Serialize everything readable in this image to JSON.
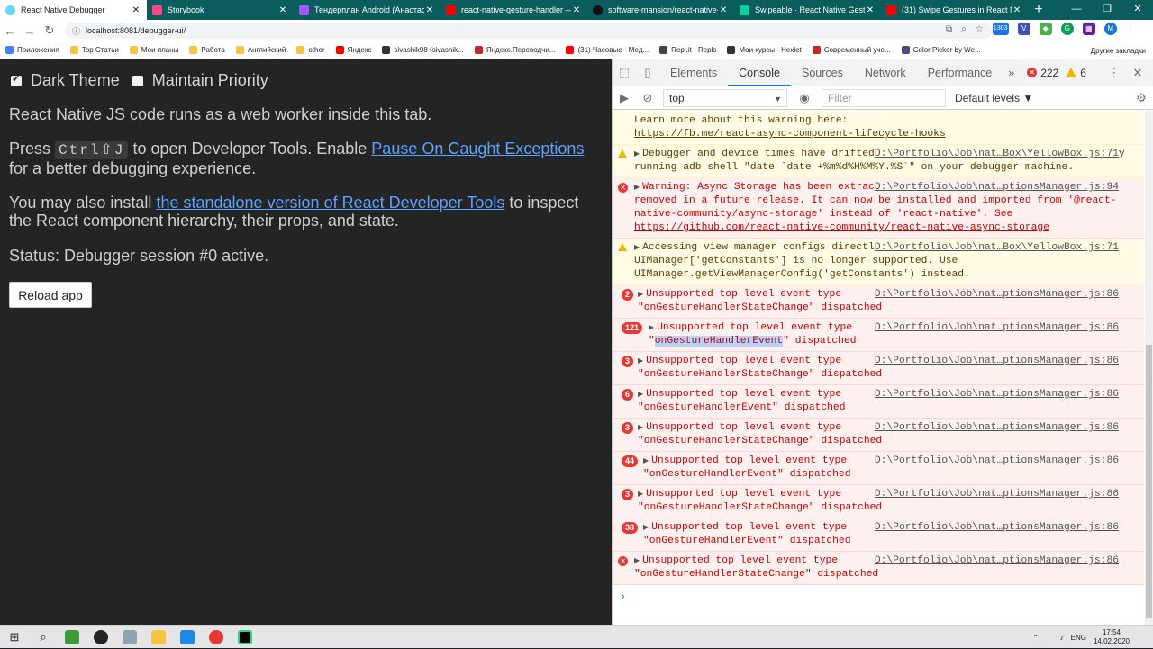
{
  "browser": {
    "tabs": [
      {
        "title": "React Native Debugger",
        "icon": "react-icon",
        "color": "#61dafb"
      },
      {
        "title": "Storybook",
        "icon": "storybook-icon",
        "color": "#ff4785"
      },
      {
        "title": "Тендерплан Android (Анастаси",
        "icon": "figma-icon",
        "color": "#a259ff"
      },
      {
        "title": "react-native-gesture-handler — ",
        "icon": "yandex-icon",
        "color": "#ff0000"
      },
      {
        "title": "software-mansion/react-native-",
        "icon": "github-icon",
        "color": "#000000"
      },
      {
        "title": "Swipeable · React Native Gesture",
        "icon": "swipe-icon",
        "color": "#0bcfa0"
      },
      {
        "title": "(31) Swipe Gestures in React Nati",
        "icon": "youtube-icon",
        "color": "#ff0000"
      }
    ],
    "new_tab": "+",
    "url": "localhost:8081/debugger-ui/",
    "bookmarks": [
      {
        "label": "Приложения",
        "color": "#4285f4"
      },
      {
        "label": "Top Статьи",
        "color": "#f6c343"
      },
      {
        "label": "Мои планы",
        "color": "#f6c343"
      },
      {
        "label": "Работа",
        "color": "#f6c343"
      },
      {
        "label": "Английский",
        "color": "#f6c343"
      },
      {
        "label": "other",
        "color": "#f6c343"
      },
      {
        "label": "Яндекс",
        "color": "#ff0000"
      },
      {
        "label": "sivashik98 (sivashik...",
        "color": "#333333"
      },
      {
        "label": "Яндекс.Переводчи...",
        "color": "#c62828"
      },
      {
        "label": "(31) Часовые - Мед...",
        "color": "#ff0000"
      },
      {
        "label": "Repl.it - Repls",
        "color": "#444444"
      },
      {
        "label": "Мои курсы - Hexlet",
        "color": "#333333"
      },
      {
        "label": "Современный уче...",
        "color": "#c62828"
      },
      {
        "label": "Color Picker by We...",
        "color": "#4a4a8a"
      }
    ],
    "other_bookmarks": "Другие закладки",
    "ext_badge": "1303"
  },
  "page": {
    "dark_theme_label": "Dark Theme",
    "maintain_priority_label": "Maintain Priority",
    "p1": "React Native JS code runs as a web worker inside this tab.",
    "p2_before": "Press ",
    "p2_kbd": "Ctrl⇧J",
    "p2_mid": " to open Developer Tools. Enable ",
    "p2_link": "Pause On Caught Exceptions",
    "p2_after": " for a better debugging experience.",
    "p3_before": "You may also install ",
    "p3_link": "the standalone version of React Developer Tools",
    "p3_after": " to inspect the React component hierarchy, their props, and state.",
    "status": "Status: Debugger session #0 active.",
    "reload_label": "Reload app"
  },
  "devtools": {
    "tabs": [
      "Elements",
      "Console",
      "Sources",
      "Network",
      "Performance"
    ],
    "active_tab": "Console",
    "more": "»",
    "error_count": "222",
    "warning_count": "6",
    "context": "top",
    "filter_placeholder": "Filter",
    "levels": "Default levels ▼",
    "messages": {
      "m0_text": "Learn more about this warning here:",
      "m0_link": "https://fb.me/react-async-component-lifecycle-hooks",
      "m1_text": "Debugger and device times have drifted by more than 60s. Please correct this by running adb shell \"date `date +%m%d%H%M%Y.%S`\" on your debugger machine.",
      "m1_src": "D:\\Portfolio\\Job\\nat…Box\\YellowBox.js:71",
      "m2_text": "Warning: Async Storage has been extracted from react-native core and will be removed in a future release. It can now be installed and imported from '@react-native-community/async-storage' instead of 'react-native'. See ",
      "m2_link": "https://github.com/react-native-community/react-native-async-storage",
      "m2_src": "D:\\Portfolio\\Job\\nat…ptionsManager.js:94",
      "m3_text": "Accessing view manager configs directly off UIManager via UIManager['getConstants'] is no longer supported. Use UIManager.getViewManagerConfig('getConstants') instead.",
      "m3_src": "D:\\Portfolio\\Job\\nat…Box\\YellowBox.js:71",
      "ev_prefix": "Unsupported top level event type",
      "ev_state": "\"onGestureHandlerStateChange\" dispatched",
      "ev_event_q": "\"",
      "ev_event_name": "onGestureHandlerEvent",
      "ev_event_tail": "\" dispatched",
      "ev_event": "\"onGestureHandlerEvent\" dispatched",
      "ev_src": "D:\\Portfolio\\Job\\nat…ptionsManager.js:86",
      "counts": [
        "2",
        "121",
        "3",
        "6",
        "3",
        "44",
        "3",
        "38"
      ]
    },
    "prompt": "›"
  },
  "taskbar": {
    "lang": "ENG",
    "time": "17:54",
    "date": "14.02.2020"
  }
}
